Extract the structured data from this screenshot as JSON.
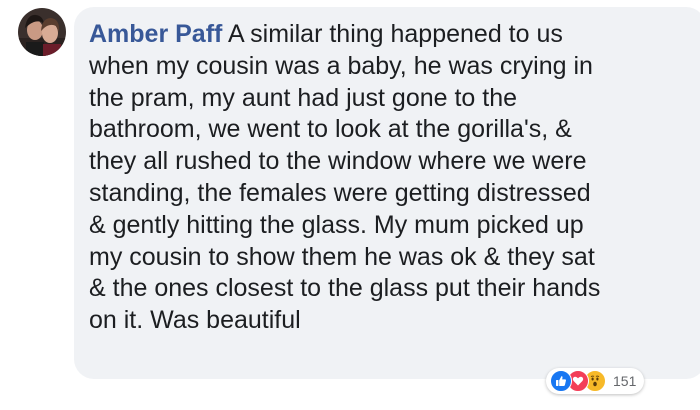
{
  "comment": {
    "author": "Amber Paff",
    "lines": [
      " A similar thing happened to us",
      "when my cousin was a baby, he was crying in",
      "the pram, my aunt had just gone to the",
      "bathroom, we went to look at the gorilla's, &",
      "they all rushed to the window where we were",
      "standing, the females were getting distressed",
      "& gently hitting the glass. My mum picked up",
      "my cousin to show them he was ok & they sat",
      "& the ones closest to the glass put their hands",
      "on it. Was beautiful"
    ]
  },
  "reactions": {
    "icons": [
      "like-icon",
      "love-icon",
      "wow-icon"
    ],
    "count": "151"
  },
  "colors": {
    "author": "#385898",
    "bubble": "#f0f2f5",
    "text": "#1c1e21",
    "like": "#1877f2",
    "love": "#f33e58",
    "wow": "#f7b928"
  }
}
